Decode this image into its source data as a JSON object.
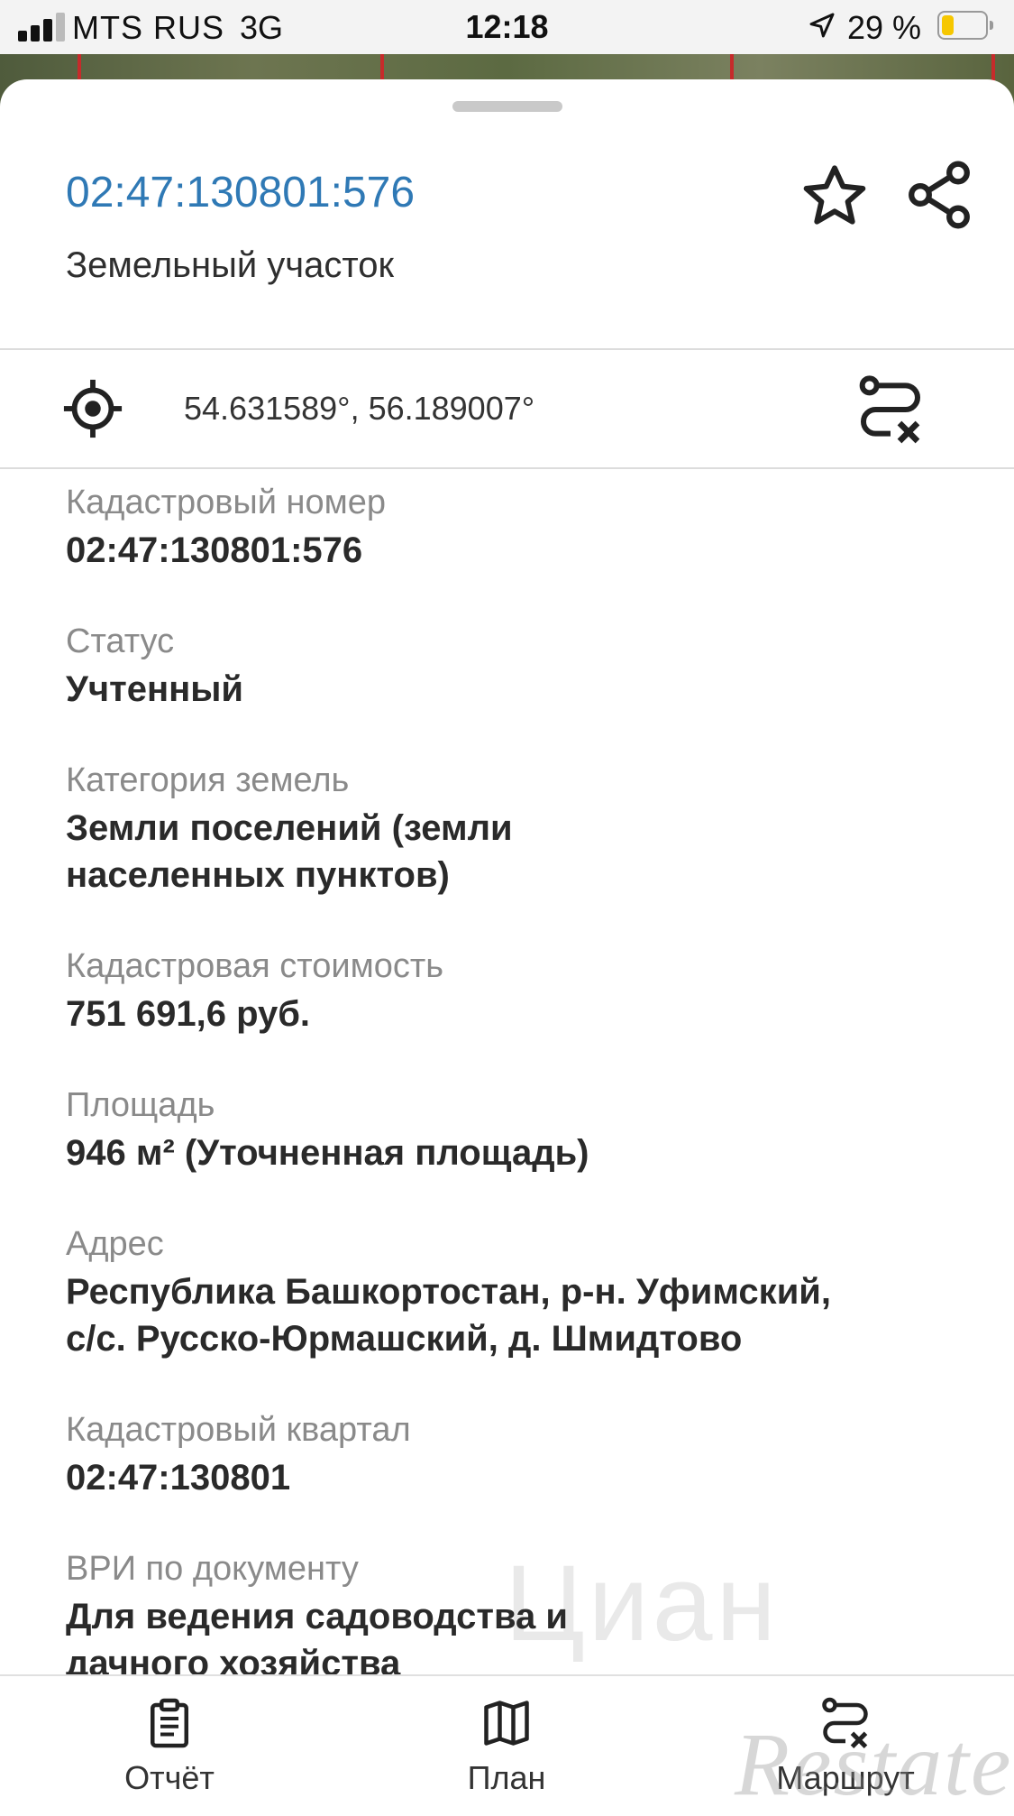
{
  "status_bar": {
    "carrier": "MTS RUS",
    "network": "3G",
    "time": "12:18",
    "battery_percent": "29 %",
    "battery_level": 0.29
  },
  "header": {
    "title": "02:47:130801:576",
    "subtitle": "Земельный участок",
    "icons": [
      "star-icon",
      "share-icon"
    ]
  },
  "coordinates": {
    "text": "54.631589°, 56.189007°",
    "icons": [
      "target-icon",
      "route-clear-icon"
    ]
  },
  "fields": [
    {
      "label": "Кадастровый номер",
      "value": "02:47:130801:576"
    },
    {
      "label": "Статус",
      "value": "Учтенный"
    },
    {
      "label": "Категория земель",
      "value_lines": [
        "Земли поселений (земли",
        "населенных пунктов)"
      ]
    },
    {
      "label": "Кадастровая стоимость",
      "value": "751 691,6 руб."
    },
    {
      "label": "Площадь",
      "value": "946 м² (Уточненная площадь)"
    },
    {
      "label": "Адрес",
      "value_lines": [
        "Республика Башкортостан, р-н. Уфимский,",
        "с/с. Русско-Юрмашский, д. Шмидтово"
      ]
    },
    {
      "label": "Кадастровый квартал",
      "value": "02:47:130801"
    },
    {
      "label": "ВРИ по документу",
      "value_lines": [
        "Для ведения садоводства и",
        "дачного хозяйства"
      ]
    }
  ],
  "tabs": [
    {
      "label": "Отчёт",
      "icon": "clipboard-icon"
    },
    {
      "label": "План",
      "icon": "map-icon"
    },
    {
      "label": "Маршрут",
      "icon": "route-icon"
    }
  ],
  "watermarks": {
    "cian": "Циан",
    "brand": "Restate"
  },
  "colors": {
    "title": "#2f79b5",
    "label": "#8a8a8a",
    "value": "#2a2a2a",
    "battery": "#f6c700"
  }
}
